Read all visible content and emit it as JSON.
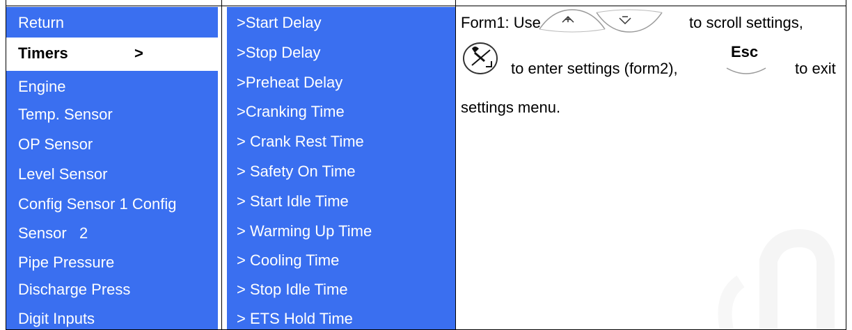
{
  "menu": {
    "items": [
      "Return",
      "Engine",
      "Temp. Sensor",
      "OP Sensor",
      "Level Sensor",
      "Config Sensor 1 Config",
      "Sensor   2",
      "Pipe Pressure",
      "Discharge Press",
      "Digit Inputs"
    ],
    "selected_label": "Timers",
    "selected_arrow": ">"
  },
  "submenu": {
    "items": [
      ">Start Delay",
      ">Stop Delay",
      ">Preheat Delay",
      ">Cranking Time",
      "> Crank Rest Time",
      "> Safety On Time",
      "> Start Idle Time",
      "> Warming Up Time",
      "> Cooling Time",
      "> Stop Idle Time",
      "> ETS Hold Time"
    ]
  },
  "instructions": {
    "line1_a": "Form1: Use",
    "line1_b": "to scroll settings,",
    "line2_a": "to enter settings (form2),",
    "line2_b": "to exit",
    "line3": "settings menu.",
    "esc_label": "Esc"
  },
  "colors": {
    "panel_blue": "#3a6ff0"
  }
}
